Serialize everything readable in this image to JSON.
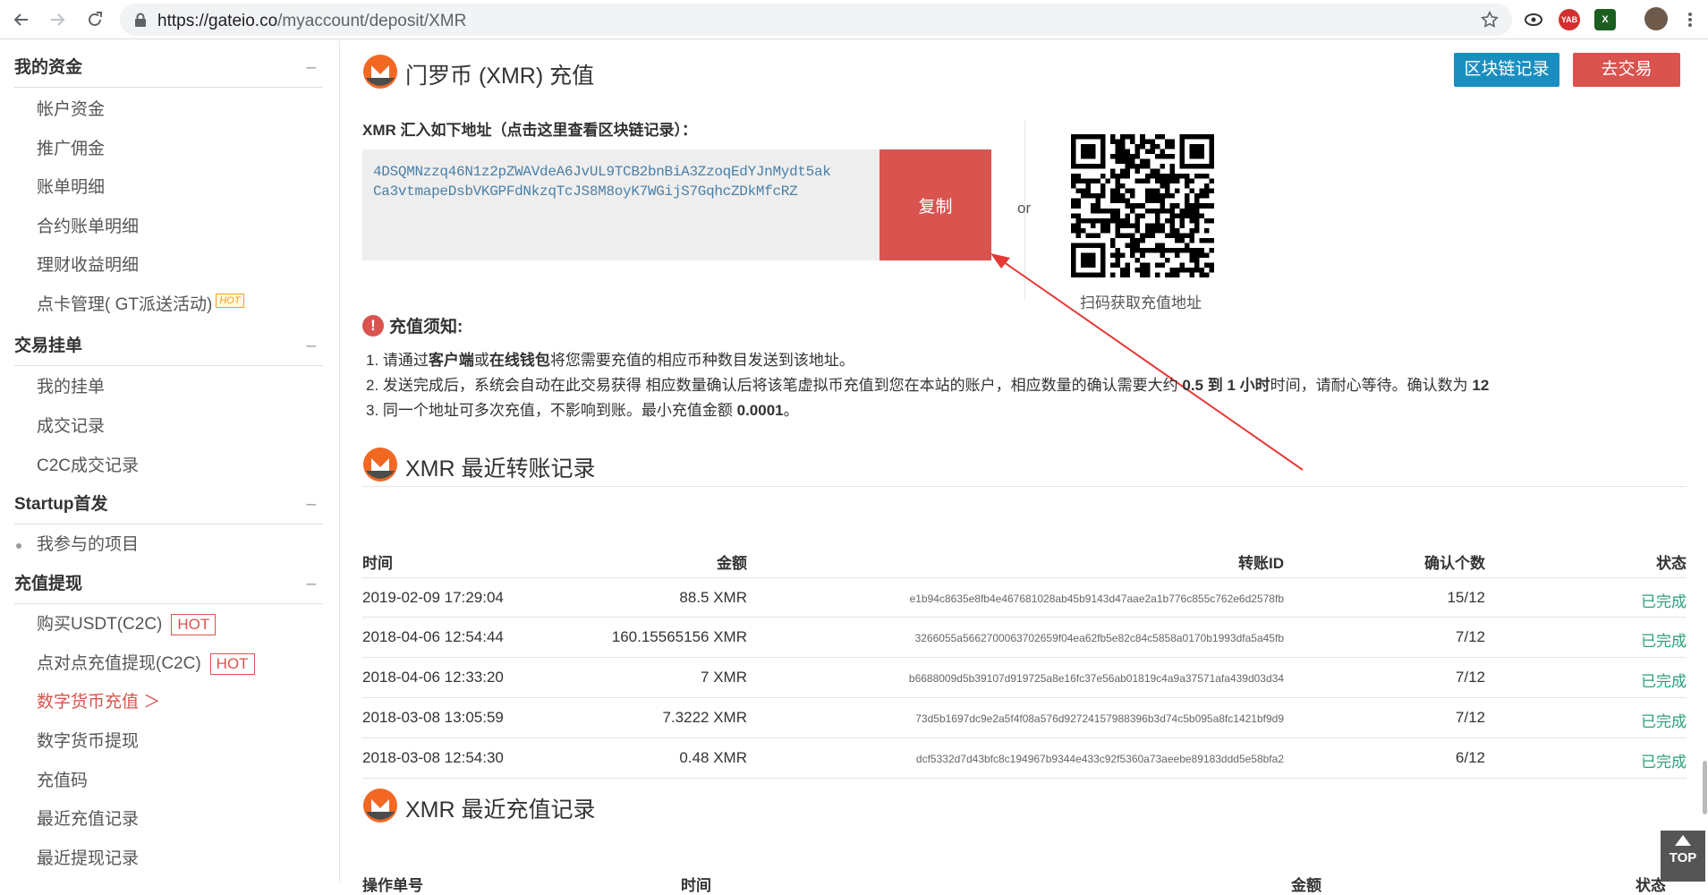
{
  "browser": {
    "url_host": "https://gateio.co",
    "url_path": "/myaccount/deposit/XMR",
    "ext_yab": "YAB",
    "ext_x": "X"
  },
  "sidebar": {
    "sections": [
      {
        "title": "我的资金",
        "toggle": "–"
      },
      {
        "title": "交易挂单",
        "toggle": "–"
      },
      {
        "title": "Startup首发",
        "toggle": "–"
      },
      {
        "title": "充值提现",
        "toggle": "–"
      }
    ],
    "items": [
      {
        "label": "帐户资金"
      },
      {
        "label": "推广佣金"
      },
      {
        "label": "账单明细"
      },
      {
        "label": "合约账单明细"
      },
      {
        "label": "理财收益明细"
      },
      {
        "label": "点卡管理( GT派送活动)",
        "badge": "HOT"
      },
      {
        "label": "我的挂单"
      },
      {
        "label": "成交记录"
      },
      {
        "label": "C2C成交记录"
      },
      {
        "label": "我参与的项目"
      },
      {
        "label": "购买USDT(C2C)",
        "badge": "HOT"
      },
      {
        "label": "点对点充值提现(C2C)",
        "badge": "HOT"
      },
      {
        "label": "数字货币充值 ＞"
      },
      {
        "label": "数字货币提现"
      },
      {
        "label": "充值码"
      },
      {
        "label": "最近充值记录"
      },
      {
        "label": "最近提现记录"
      }
    ]
  },
  "main": {
    "title": "门罗币 (XMR) 充值",
    "btn_chain": "区块链记录",
    "btn_trade": "去交易",
    "addr_label": "XMR 汇入如下地址（点击这里查看区块链记录）：",
    "address_line1": "4DSQMNzzq46N1z2pZWAVdeA6JvUL9TCB2bnBiA3ZzoqEdYJnMydt5ak",
    "address_line2": "Ca3vtmapeDsbVKGPFdNkzqTcJS8M8oyK7WGijS7GqhcZDkMfcRZ",
    "copy_btn": "复制",
    "or": "or",
    "qr_caption": "扫码获取充值地址",
    "notice_title": "充值须知:",
    "notice": {
      "l1_a": "1. 请通过",
      "l1_b": "客户端",
      "l1_c": "或",
      "l1_d": "在线钱包",
      "l1_e": "将您需要充值的相应币种数目发送到该地址。",
      "l2_a": "2. 发送完成后，系统会自动在此交易获得 相应数量确认后将该笔虚拟币充值到您在本站的账户，相应数量的确认需要大约 ",
      "l2_b": "0.5 到 1 小时",
      "l2_c": "时间，请耐心等待。确认数为 ",
      "l2_d": "12",
      "l3_a": "3. 同一个地址可多次充值，不影响到账。最小充值金额 ",
      "l3_b": "0.0001",
      "l3_c": "。"
    },
    "transfers_title": "XMR 最近转账记录",
    "deposits_title": "XMR 最近充值记录",
    "deposit_headers": [
      "操作单号",
      "时间",
      "金额",
      "状态"
    ],
    "headers": {
      "time": "时间",
      "amount": "金额",
      "txid": "转账ID",
      "confirms": "确认个数",
      "status": "状态"
    },
    "rows": [
      {
        "time": "2019-02-09 17:29:04",
        "amount": "88.5 XMR",
        "txid": "e1b94c8635e8fb4e467681028ab45b9143d47aae2a1b776c855c762e6d2578fb",
        "confirms": "15/12",
        "status": "已完成"
      },
      {
        "time": "2018-04-06 12:54:44",
        "amount": "160.15565156 XMR",
        "txid": "3266055a5662700063702659f04ea62fb5e82c84c5858a0170b1993dfa5a45fb",
        "confirms": "7/12",
        "status": "已完成"
      },
      {
        "time": "2018-04-06 12:33:20",
        "amount": "7 XMR",
        "txid": "b6688009d5b39107d919725a8e16fc37e56ab01819c4a9a37571afa439d03d34",
        "confirms": "7/12",
        "status": "已完成"
      },
      {
        "time": "2018-03-08 13:05:59",
        "amount": "7.3222 XMR",
        "txid": "73d5b1697dc9e2a5f4f08a576d92724157988396b3d74c5b095a8fc1421bf9d9",
        "confirms": "7/12",
        "status": "已完成"
      },
      {
        "time": "2018-03-08 12:54:30",
        "amount": "0.48 XMR",
        "txid": "dcf5332d7d43bfc8c194967b9344e433c92f5360a73aeebe89183ddd5e58bfa2",
        "confirms": "6/12",
        "status": "已完成"
      }
    ],
    "top_btn": "TOP"
  },
  "colors": {
    "accent_red": "#d9534f",
    "chain_btn": "#1a8fbf",
    "done_green": "#2e9e7e"
  }
}
